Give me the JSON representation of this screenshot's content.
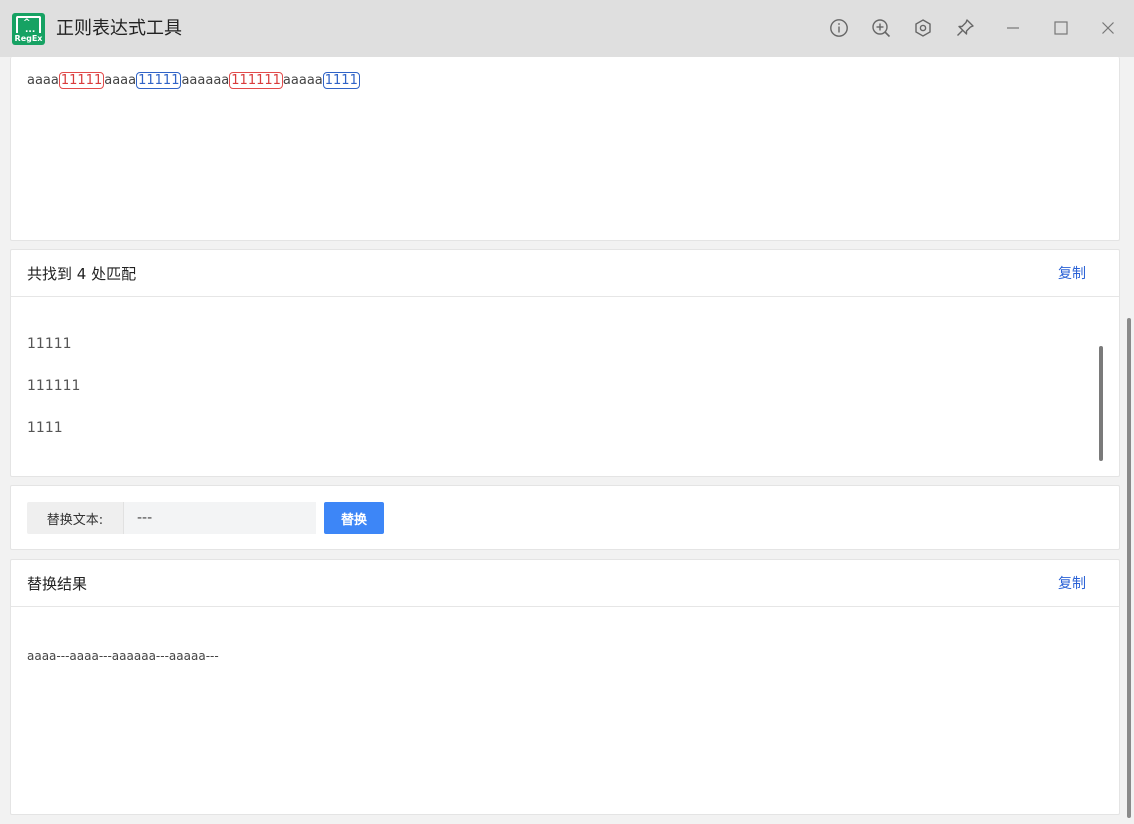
{
  "window": {
    "title": "正则表达式工具",
    "logo_text": "RegEx",
    "logo_glyph": "^",
    "logo_dots": "...",
    "buttons": [
      "info-icon",
      "zoom-in-icon",
      "settings-icon",
      "pin-icon",
      "minimize-icon",
      "maximize-icon",
      "close-icon"
    ]
  },
  "source": {
    "segments": [
      {
        "text": "aaaa",
        "match": ""
      },
      {
        "text": "11111",
        "match": "red"
      },
      {
        "text": "aaaa",
        "match": ""
      },
      {
        "text": "11111",
        "match": "blue"
      },
      {
        "text": "aaaaaa",
        "match": ""
      },
      {
        "text": "111111",
        "match": "red"
      },
      {
        "text": "aaaaa",
        "match": ""
      },
      {
        "text": "1111",
        "match": "blue"
      }
    ]
  },
  "matches": {
    "title": "共找到 4 处匹配",
    "copy_label": "复制",
    "items": [
      "11111",
      "111111",
      "1111"
    ]
  },
  "replace": {
    "label": "替换文本:",
    "value": "---",
    "button_label": "替换"
  },
  "result": {
    "title": "替换结果",
    "copy_label": "复制",
    "text": "aaaa---aaaa---aaaaaa---aaaaa---"
  },
  "colors": {
    "accent": "#3d86f7",
    "link": "#2b62d6",
    "match_red": "#d93b3b",
    "match_blue": "#2f63c7",
    "logo": "#16a263"
  }
}
